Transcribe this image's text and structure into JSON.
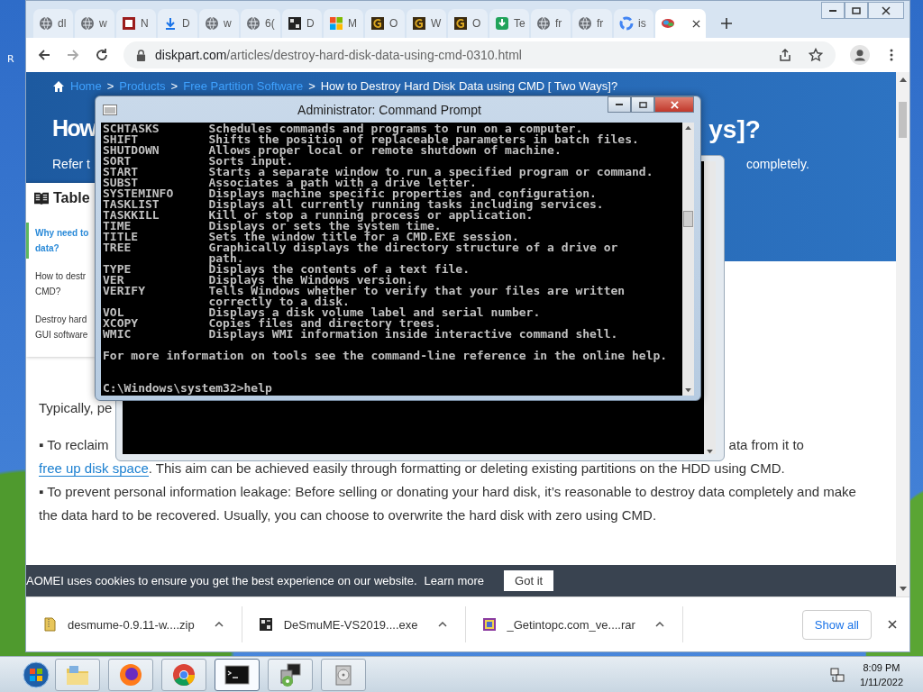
{
  "desktop": {
    "icon_label": "R"
  },
  "browser": {
    "tabs": [
      {
        "title": "dl",
        "kind": "globe",
        "selected": false
      },
      {
        "title": "w",
        "kind": "globe",
        "selected": false
      },
      {
        "title": "N",
        "kind": "redpage",
        "selected": false
      },
      {
        "title": "D",
        "kind": "download",
        "selected": false
      },
      {
        "title": "w",
        "kind": "globe",
        "selected": false
      },
      {
        "title": "6(",
        "kind": "globe",
        "selected": false
      },
      {
        "title": "D",
        "kind": "grid",
        "selected": false
      },
      {
        "title": "M",
        "kind": "squares",
        "selected": false
      },
      {
        "title": "O",
        "kind": "gold",
        "selected": false
      },
      {
        "title": "W",
        "kind": "gold",
        "selected": false
      },
      {
        "title": "O",
        "kind": "gold",
        "selected": false
      },
      {
        "title": "Te",
        "kind": "green",
        "selected": false
      },
      {
        "title": "fr",
        "kind": "globe",
        "selected": false
      },
      {
        "title": "fr",
        "kind": "globe",
        "selected": false
      },
      {
        "title": "is",
        "kind": "ring",
        "selected": false
      },
      {
        "kind": "blob",
        "selected": true
      }
    ],
    "url": {
      "host": "diskpart.com",
      "path": "/articles/destroy-hard-disk-data-using-cmd-0310.html"
    }
  },
  "page": {
    "breadcrumb": [
      {
        "label": "Home",
        "link": true
      },
      {
        "label": "Products",
        "link": true
      },
      {
        "label": "Free Partition Software",
        "link": true
      },
      {
        "label": "How to Destroy Hard Disk Data using CMD [ Two Ways]?",
        "link": false
      }
    ],
    "separator": ">",
    "title_fragments": [
      "How",
      "ys]?"
    ],
    "intro_fragments": [
      "Refer t",
      "completely."
    ],
    "toc": {
      "title": "Table",
      "items": [
        {
          "lines": [
            "Why need to",
            "data?"
          ],
          "selected": true
        },
        {
          "lines": [
            "How to destr",
            "CMD?"
          ],
          "selected": false
        },
        {
          "lines": [
            "Destroy hard",
            "GUI software"
          ],
          "selected": false
        }
      ]
    },
    "paragraph_start": "Typically, pe",
    "bullet_1": {
      "start": "▪  To reclaim",
      "tail": "ata from it to",
      "link": "free up disk space",
      "after_link": ". This aim can be achieved easily through formatting or deleting existing partitions on the HDD using CMD."
    },
    "bullet_2": "▪  To prevent personal information leakage: Before selling or donating your hard disk, it’s reasonable to destroy data completely and make the data hard to be recovered. Usually, you can choose to overwrite the hard disk with zero using CMD.",
    "cookie_bar": {
      "text": "AOMEI uses cookies to ensure you get the best experience on our website.",
      "link": "Learn more",
      "button": "Got it"
    }
  },
  "downloads": {
    "items": [
      {
        "name": "desmume-0.9.11-w....zip",
        "kind": "zip"
      },
      {
        "name": "DeSmuME-VS2019....exe",
        "kind": "exe"
      },
      {
        "name": "_Getintopc.com_ve....rar",
        "kind": "rar"
      }
    ],
    "show_all": "Show all"
  },
  "cmd": {
    "title": "Administrator: Command Prompt",
    "lines": [
      "SCHTASKS       Schedules commands and programs to run on a computer.",
      "SHIFT          Shifts the position of replaceable parameters in batch files.",
      "SHUTDOWN       Allows proper local or remote shutdown of machine.",
      "SORT           Sorts input.",
      "START          Starts a separate window to run a specified program or command.",
      "SUBST          Associates a path with a drive letter.",
      "SYSTEMINFO     Displays machine specific properties and configuration.",
      "TASKLIST       Displays all currently running tasks including services.",
      "TASKKILL       Kill or stop a running process or application.",
      "TIME           Displays or sets the system time.",
      "TITLE          Sets the window title for a CMD.EXE session.",
      "TREE           Graphically displays the directory structure of a drive or",
      "               path.",
      "TYPE           Displays the contents of a text file.",
      "VER            Displays the Windows version.",
      "VERIFY         Tells Windows whether to verify that your files are written",
      "               correctly to a disk.",
      "VOL            Displays a disk volume label and serial number.",
      "XCOPY          Copies files and directory trees.",
      "WMIC           Displays WMI information inside interactive command shell."
    ],
    "footer": "For more information on tools see the command-line reference in the online help.",
    "prompt": "C:\\Windows\\system32>help"
  },
  "taskbar": {
    "apps": [
      {
        "kind": "folder",
        "selected": false
      },
      {
        "kind": "fox",
        "selected": false
      },
      {
        "kind": "wheel",
        "selected": false
      },
      {
        "kind": "console",
        "selected": true
      },
      {
        "kind": "installer",
        "selected": false
      },
      {
        "kind": "disc",
        "selected": false
      }
    ],
    "time": "8:09 PM",
    "date": "1/11/2022"
  }
}
